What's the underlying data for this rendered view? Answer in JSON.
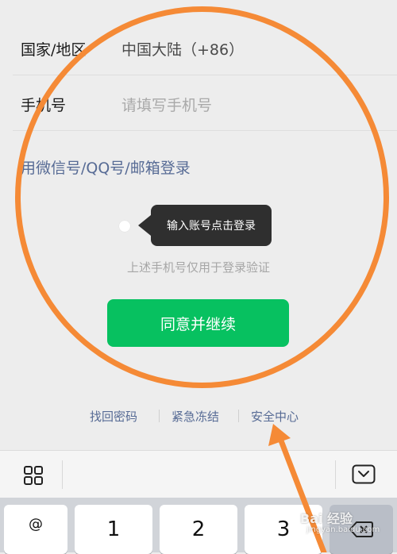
{
  "form": {
    "region_label": "国家/地区",
    "region_value": "中国大陆（+86）",
    "phone_label": "手机号",
    "phone_placeholder": "请填写手机号",
    "alt_login_link": "用微信号/QQ号/邮箱登录"
  },
  "tooltip": {
    "text": "输入账号点击登录"
  },
  "hint": "上述手机号仅用于登录验证",
  "primary_button": "同意并继续",
  "footer_links": [
    "找回密码",
    "紧急冻结",
    "安全中心"
  ],
  "keyboard": {
    "toolbar": {
      "left_icon": "grid-icon",
      "right_icon": "keyboard-hide-icon"
    },
    "keys": [
      "@",
      "1",
      "2",
      "3"
    ],
    "delete_icon": "backspace-icon"
  },
  "overlay": {
    "annotation_color": "#f58a36"
  },
  "watermark": {
    "text": "Bai 经验",
    "sub": "jingyan.baidu.com"
  },
  "colors": {
    "accent_green": "#07c160",
    "link_blue": "#576b95",
    "background": "#ededed"
  }
}
